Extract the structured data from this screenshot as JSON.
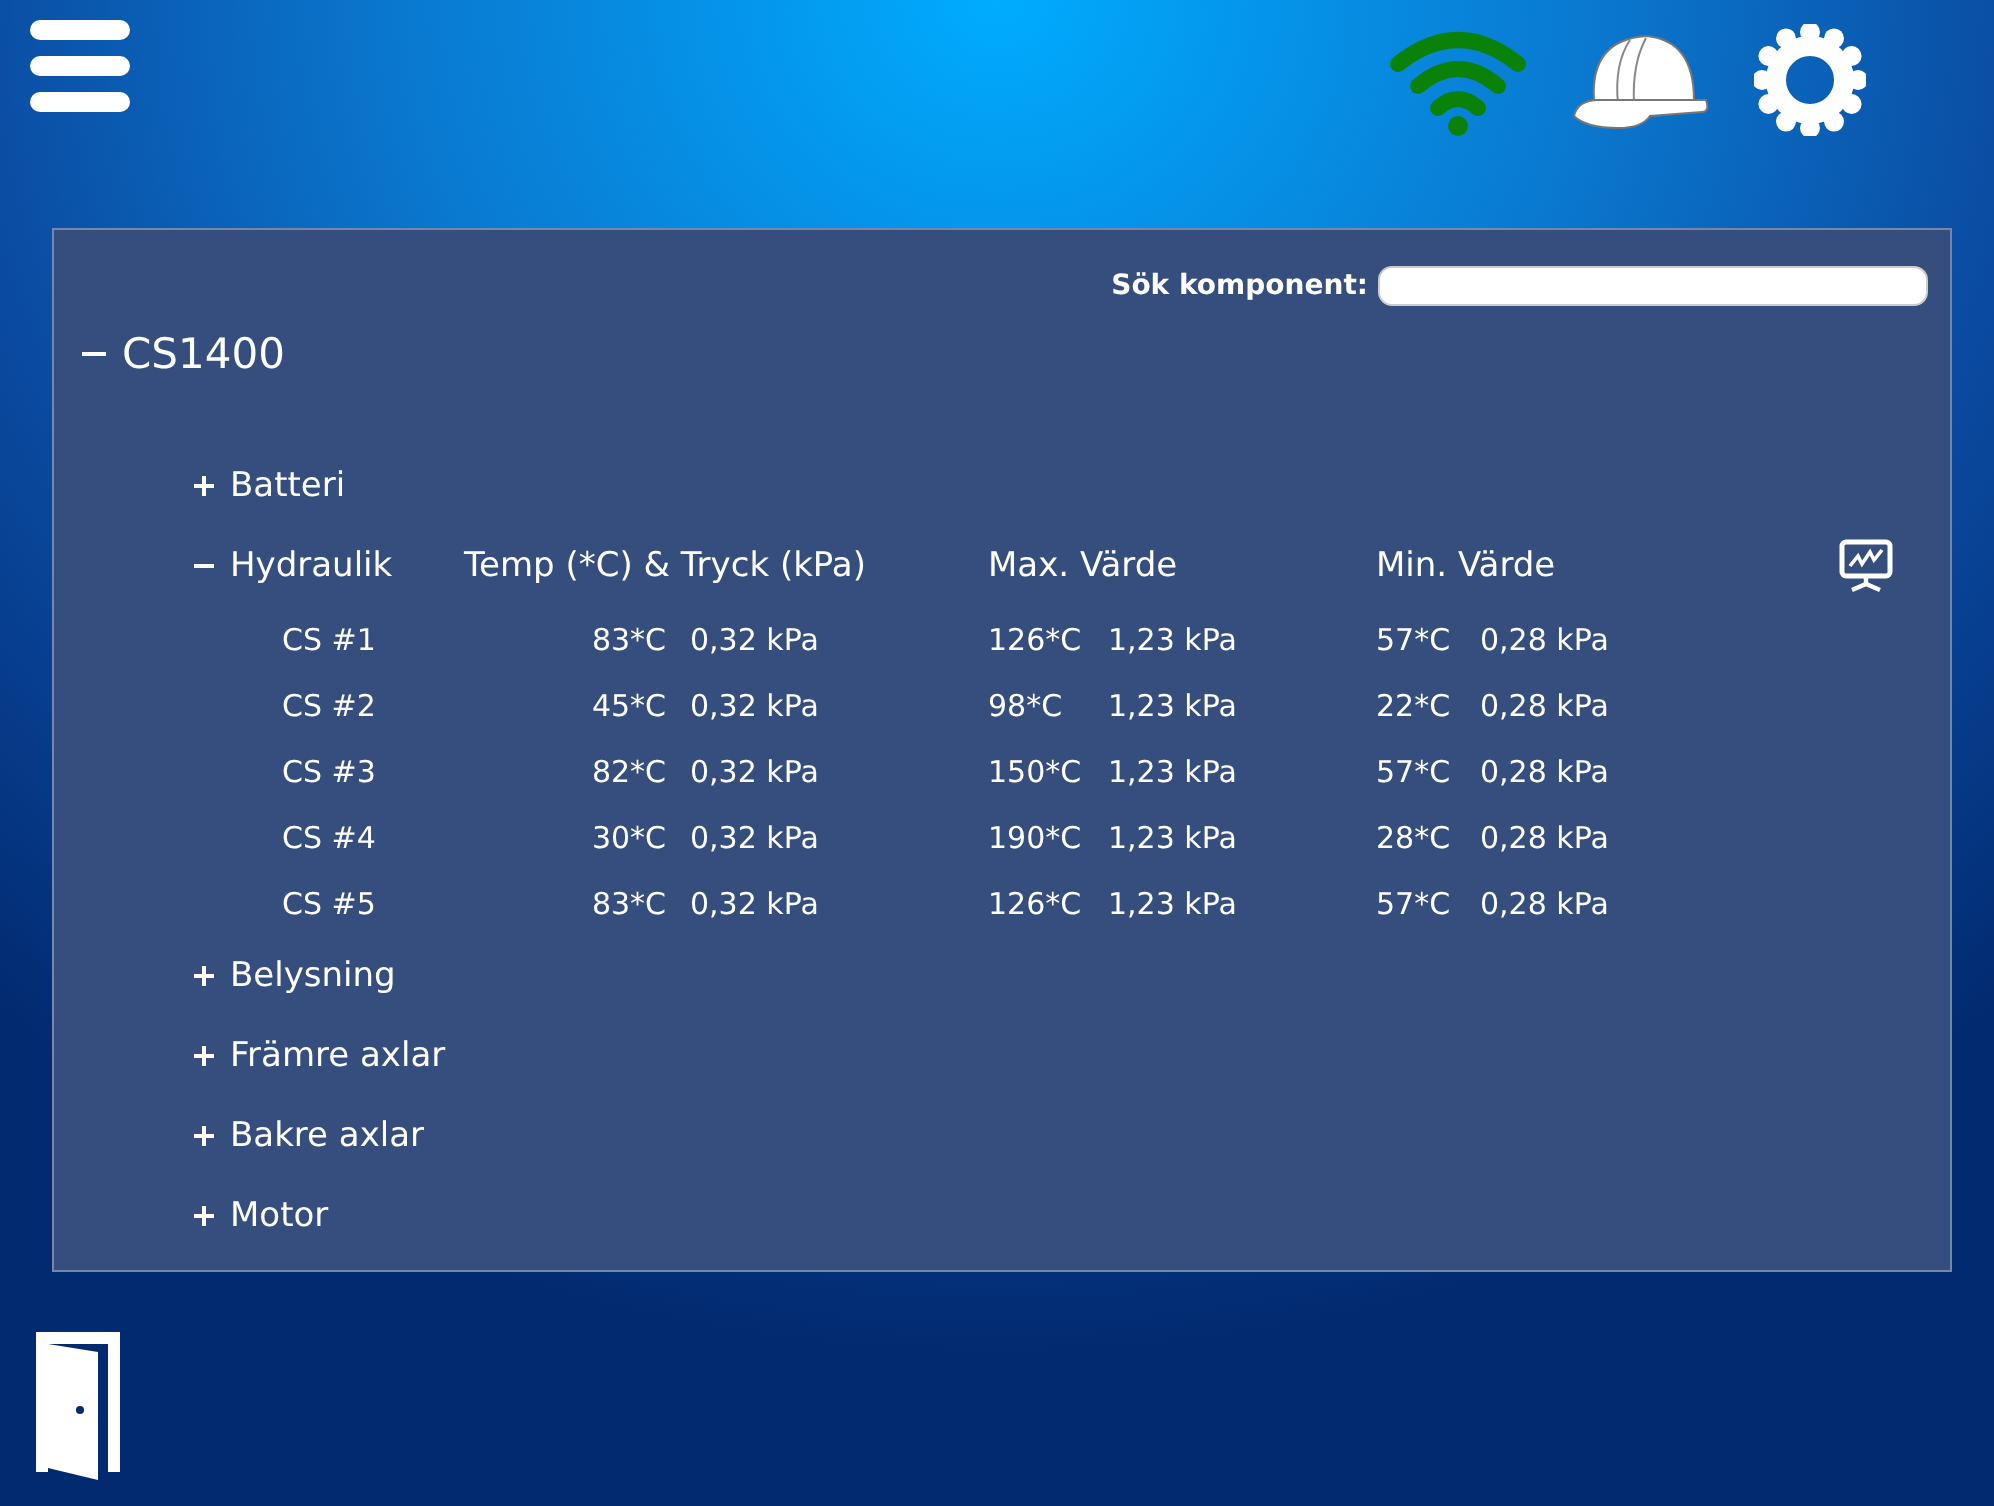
{
  "search": {
    "label": "Sök komponent:"
  },
  "tree": {
    "label": "CS1400",
    "expanded": true,
    "children": [
      {
        "label": "Batteri",
        "expanded": false
      },
      {
        "label": "Hydraulik",
        "expanded": true,
        "columns": [
          "Temp (*C) & Tryck (kPa)",
          "Max. Värde",
          "Min. Värde"
        ],
        "rows": [
          {
            "name": "CS #1",
            "temp": "83*C",
            "pressure": "0,32 kPa",
            "max_temp": "126*C",
            "max_pressure": "1,23 kPa",
            "min_temp": "57*C",
            "min_pressure": "0,28 kPa"
          },
          {
            "name": "CS #2",
            "temp": "45*C",
            "pressure": "0,32 kPa",
            "max_temp": "98*C",
            "max_pressure": "1,23 kPa",
            "min_temp": "22*C",
            "min_pressure": "0,28 kPa"
          },
          {
            "name": "CS #3",
            "temp": "82*C",
            "pressure": "0,32 kPa",
            "max_temp": "150*C",
            "max_pressure": "1,23 kPa",
            "min_temp": "57*C",
            "min_pressure": "0,28 kPa"
          },
          {
            "name": "CS #4",
            "temp": "30*C",
            "pressure": "0,32 kPa",
            "max_temp": "190*C",
            "max_pressure": "1,23 kPa",
            "min_temp": "28*C",
            "min_pressure": "0,28 kPa"
          },
          {
            "name": "CS #5",
            "temp": "83*C",
            "pressure": "0,32 kPa",
            "max_temp": "126*C",
            "max_pressure": "1,23 kPa",
            "min_temp": "57*C",
            "min_pressure": "0,28 kPa"
          }
        ]
      },
      {
        "label": "Belysning",
        "expanded": false
      },
      {
        "label": "Främre axlar",
        "expanded": false
      },
      {
        "label": "Bakre axlar",
        "expanded": false
      },
      {
        "label": "Motor",
        "expanded": false
      }
    ]
  }
}
